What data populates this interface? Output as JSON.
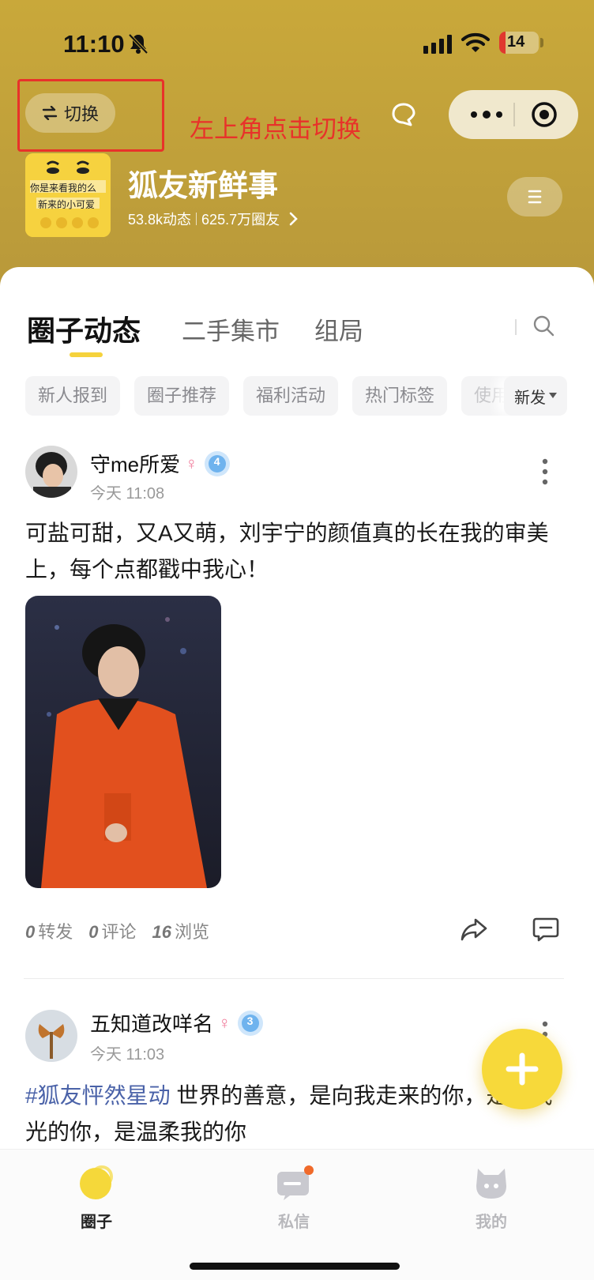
{
  "status_bar": {
    "time": "11:10",
    "battery": "14"
  },
  "header": {
    "switch_label": "切换",
    "annotation": "左上角点击切换",
    "group_name": "狐友新鲜事",
    "posts_count": "53.8k动态",
    "members_count": "625.7万圈友",
    "avatar_line1": "你是来看我的么",
    "avatar_line2": "新来的小可爱"
  },
  "tabs": [
    "圈子动态",
    "二手集市",
    "组局"
  ],
  "tags": [
    "新人报到",
    "圈子推荐",
    "福利活动",
    "热门标签",
    "使用"
  ],
  "sort_label": "新发",
  "posts": [
    {
      "author": "守me所爱",
      "gender": "♀",
      "level": "4",
      "time": "今天 11:08",
      "text": "可盐可甜，又A又萌，刘宇宁的颜值真的长在我的审美上，每个点都戳中我心！",
      "reposts": "0",
      "repost_label": "转发",
      "comments": "0",
      "comment_label": "评论",
      "views": "16",
      "view_label": "浏览"
    },
    {
      "author": "五知道改咩名",
      "gender": "♀",
      "level": "3",
      "time": "今天 11:03",
      "hashtag": "#狐友怦然星动",
      "text": " 世界的善意，是向我走来的你，是给我光的你，是温柔我的你"
    }
  ],
  "nav": [
    {
      "label": "圈子"
    },
    {
      "label": "私信"
    },
    {
      "label": "我的"
    }
  ],
  "colors": {
    "accent": "#f5d23c",
    "header": "#c2a23a",
    "annotation": "#e8322a",
    "hashtag": "#4a62a8"
  }
}
